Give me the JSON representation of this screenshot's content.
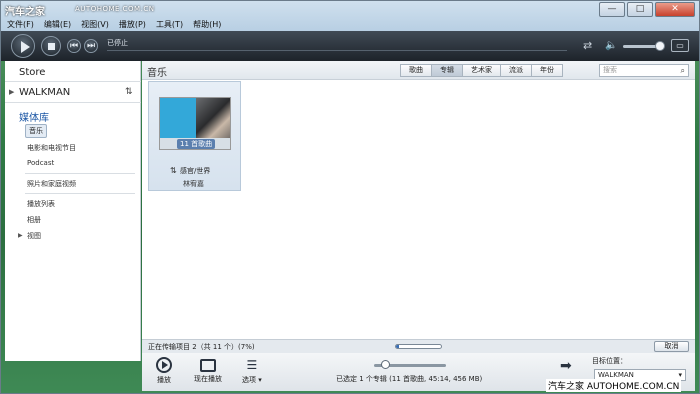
{
  "watermark": {
    "logo": "汽车之家",
    "url": "AUTOHOME.COM.CN",
    "bottom": "汽车之家 AUTOHOME.COM.CN"
  },
  "menu": [
    "文件(F)",
    "编辑(E)",
    "视图(V)",
    "播放(P)",
    "工具(T)",
    "帮助(H)"
  ],
  "window_controls": {
    "minimize": "—",
    "maximize": "□",
    "close": "✕"
  },
  "player": {
    "status": "已停止",
    "repeat_icon": "repeat-icon",
    "volume_level": 0.85,
    "mini_label": "▭"
  },
  "sidebar": {
    "store": "Store",
    "device": "WALKMAN",
    "library": "媒体库",
    "library_items": [
      {
        "label": "音乐",
        "selected": true
      },
      {
        "label": "电影和电视节目"
      },
      {
        "label": "Podcast"
      },
      {
        "label": "照片和家庭视频"
      },
      {
        "label": "播放列表"
      },
      {
        "label": "相册"
      },
      {
        "label": "视图",
        "expandable": true
      }
    ]
  },
  "main": {
    "title": "音乐",
    "tabs": [
      {
        "label": "歌曲"
      },
      {
        "label": "专辑",
        "active": true
      },
      {
        "label": "艺术家"
      },
      {
        "label": "流派"
      },
      {
        "label": "年份"
      }
    ],
    "search_placeholder": "搜索",
    "album": {
      "song_count": "11 首歌曲",
      "title": "感官/世界",
      "artist": "林宥嘉"
    }
  },
  "transfer": {
    "text": "正在传输项目 2（共 11 个）(7%)",
    "progress": 0.07,
    "cancel": "取消"
  },
  "bottombar": {
    "play": "播放",
    "now_playing": "现在播放",
    "options": "选项",
    "selected_info": "已选定 1 个专辑 (11 首歌曲, 45:14, 456 MB)",
    "zoom_level": 0.15,
    "target_label": "目标位置：",
    "target_value": "WALKMAN"
  }
}
